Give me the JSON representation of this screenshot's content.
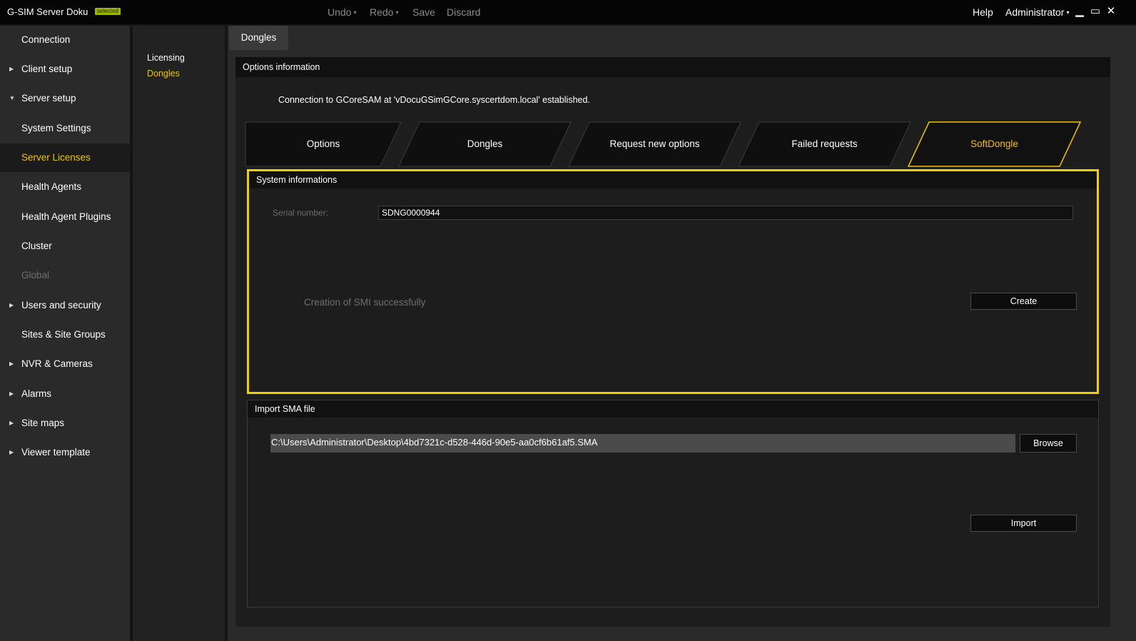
{
  "titlebar": {
    "app_title": "G-SIM Server Doku",
    "badge": "selected",
    "undo": "Undo",
    "redo": "Redo",
    "save": "Save",
    "discard": "Discard",
    "help": "Help",
    "user": "Administrator",
    "caret": "▾",
    "minimize": "▁",
    "maximize": "▭",
    "close": "✕"
  },
  "nav": {
    "items": [
      {
        "label": "Connection",
        "arrow": ""
      },
      {
        "label": "Client setup",
        "arrow": "▶"
      },
      {
        "label": "Server setup",
        "arrow": "▼"
      },
      {
        "label": "System Settings",
        "arrow": ""
      },
      {
        "label": "Server Licenses",
        "arrow": ""
      },
      {
        "label": "Health Agents",
        "arrow": ""
      },
      {
        "label": "Health Agent Plugins",
        "arrow": ""
      },
      {
        "label": "Cluster",
        "arrow": ""
      },
      {
        "label": "Global",
        "arrow": ""
      },
      {
        "label": "Users and security",
        "arrow": "▶"
      },
      {
        "label": "Sites & Site Groups",
        "arrow": ""
      },
      {
        "label": "NVR & Cameras",
        "arrow": "▶"
      },
      {
        "label": "Alarms",
        "arrow": "▶"
      },
      {
        "label": "Site maps",
        "arrow": "▶"
      },
      {
        "label": "Viewer template",
        "arrow": "▶"
      }
    ],
    "active_item": "Server Licenses",
    "disabled_item": "Global"
  },
  "subnav": {
    "items": [
      {
        "label": "Licensing"
      },
      {
        "label": "Dongles"
      }
    ],
    "active_item": "Dongles"
  },
  "main": {
    "page_tab": "Dongles",
    "panel_title": "Options information",
    "connection_message": "Connection to GCoreSAM at 'vDocuGSimGCore.syscertdom.local' established.",
    "option_tabs": [
      {
        "label": "Options"
      },
      {
        "label": "Dongles"
      },
      {
        "label": "Request new options"
      },
      {
        "label": "Failed requests"
      },
      {
        "label": "SoftDongle"
      }
    ],
    "active_option_tab": "SoftDongle",
    "system_info": {
      "title": "System informations",
      "serial_label": "Serial number:",
      "serial_value": "SDNG0000944",
      "status_message": "Creation of SMI successfully",
      "create_button": "Create"
    },
    "import_sma": {
      "title": "Import SMA file",
      "path_value": "C:\\Users\\Administrator\\Desktop\\4bd7321c-d528-446d-90e5-aa0cf6b61af5.SMA",
      "browse_button": "Browse",
      "import_button": "Import"
    }
  },
  "colors": {
    "accent": "#f2c200",
    "badge": "#9fb400",
    "highlight_border": "#f2d000"
  }
}
